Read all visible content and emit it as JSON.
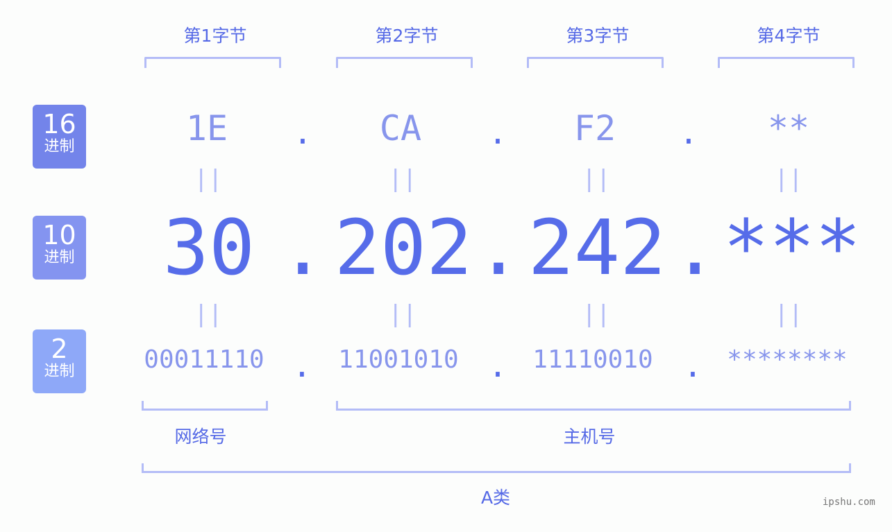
{
  "byte_labels": [
    "第1字节",
    "第2字节",
    "第3字节",
    "第4字节"
  ],
  "bases": [
    {
      "num": "16",
      "unit": "进制",
      "color": "#7384ea"
    },
    {
      "num": "10",
      "unit": "进制",
      "color": "#8494f0"
    },
    {
      "num": "2",
      "unit": "进制",
      "color": "#8ea8f8"
    }
  ],
  "hex": [
    "1E",
    "CA",
    "F2",
    "**"
  ],
  "decimal": [
    "30",
    "202",
    "242",
    "***"
  ],
  "binary": [
    "00011110",
    "11001010",
    "11110010",
    "********"
  ],
  "separator": ".",
  "equals": "||",
  "groups": {
    "network": "网络号",
    "host": "主机号",
    "class": "A类"
  },
  "watermark": "ipshu.com",
  "colors": {
    "accent": "#566ce9",
    "light": "#8795ec",
    "bracket": "#b3bcf7"
  }
}
